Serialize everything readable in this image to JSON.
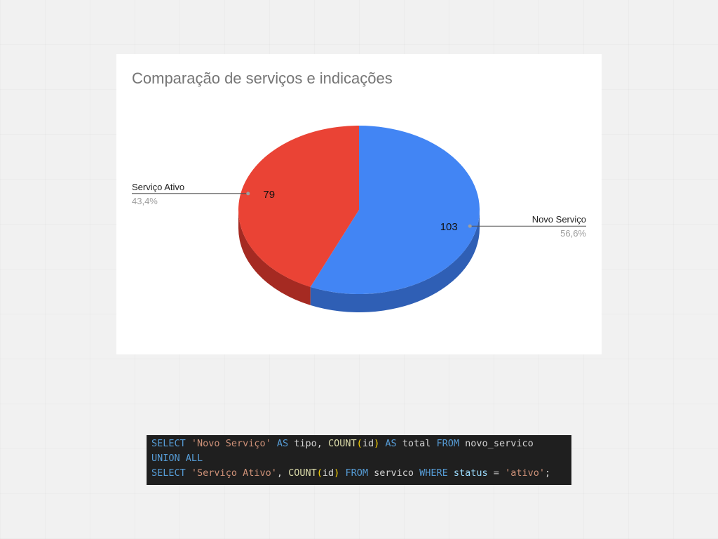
{
  "chart_data": {
    "type": "pie",
    "style": "3d",
    "title": "Comparação de serviços e indicações",
    "slices": [
      {
        "label": "Novo Serviço",
        "value": 103,
        "percent": "56,6%",
        "color": "#4285f4",
        "side_color": "#2f5fb5"
      },
      {
        "label": "Serviço Ativo",
        "value": 79,
        "percent": "43,4%",
        "color": "#ea4335",
        "side_color": "#a52a22"
      }
    ]
  },
  "code": {
    "lines": [
      [
        {
          "t": "SELECT",
          "c": "kw"
        },
        {
          "t": " ",
          "c": "plain"
        },
        {
          "t": "'Novo Serviço'",
          "c": "str"
        },
        {
          "t": " ",
          "c": "plain"
        },
        {
          "t": "AS",
          "c": "kw"
        },
        {
          "t": " tipo, ",
          "c": "plain"
        },
        {
          "t": "COUNT",
          "c": "fn"
        },
        {
          "t": "(",
          "c": "paren"
        },
        {
          "t": "id",
          "c": "plain"
        },
        {
          "t": ")",
          "c": "paren"
        },
        {
          "t": " ",
          "c": "plain"
        },
        {
          "t": "AS",
          "c": "kw"
        },
        {
          "t": " total ",
          "c": "plain"
        },
        {
          "t": "FROM",
          "c": "kw"
        },
        {
          "t": " novo_servico",
          "c": "plain"
        }
      ],
      [
        {
          "t": "UNION ALL",
          "c": "kw"
        }
      ],
      [
        {
          "t": "SELECT",
          "c": "kw"
        },
        {
          "t": " ",
          "c": "plain"
        },
        {
          "t": "'Serviço Ativo'",
          "c": "str"
        },
        {
          "t": ", ",
          "c": "plain"
        },
        {
          "t": "COUNT",
          "c": "fn"
        },
        {
          "t": "(",
          "c": "paren"
        },
        {
          "t": "id",
          "c": "plain"
        },
        {
          "t": ")",
          "c": "paren"
        },
        {
          "t": " ",
          "c": "plain"
        },
        {
          "t": "FROM",
          "c": "kw"
        },
        {
          "t": " servico ",
          "c": "plain"
        },
        {
          "t": "WHERE",
          "c": "kw"
        },
        {
          "t": " ",
          "c": "plain"
        },
        {
          "t": "status",
          "c": "col"
        },
        {
          "t": " = ",
          "c": "plain"
        },
        {
          "t": "'ativo'",
          "c": "str"
        },
        {
          "t": ";",
          "c": "plain"
        }
      ]
    ]
  }
}
